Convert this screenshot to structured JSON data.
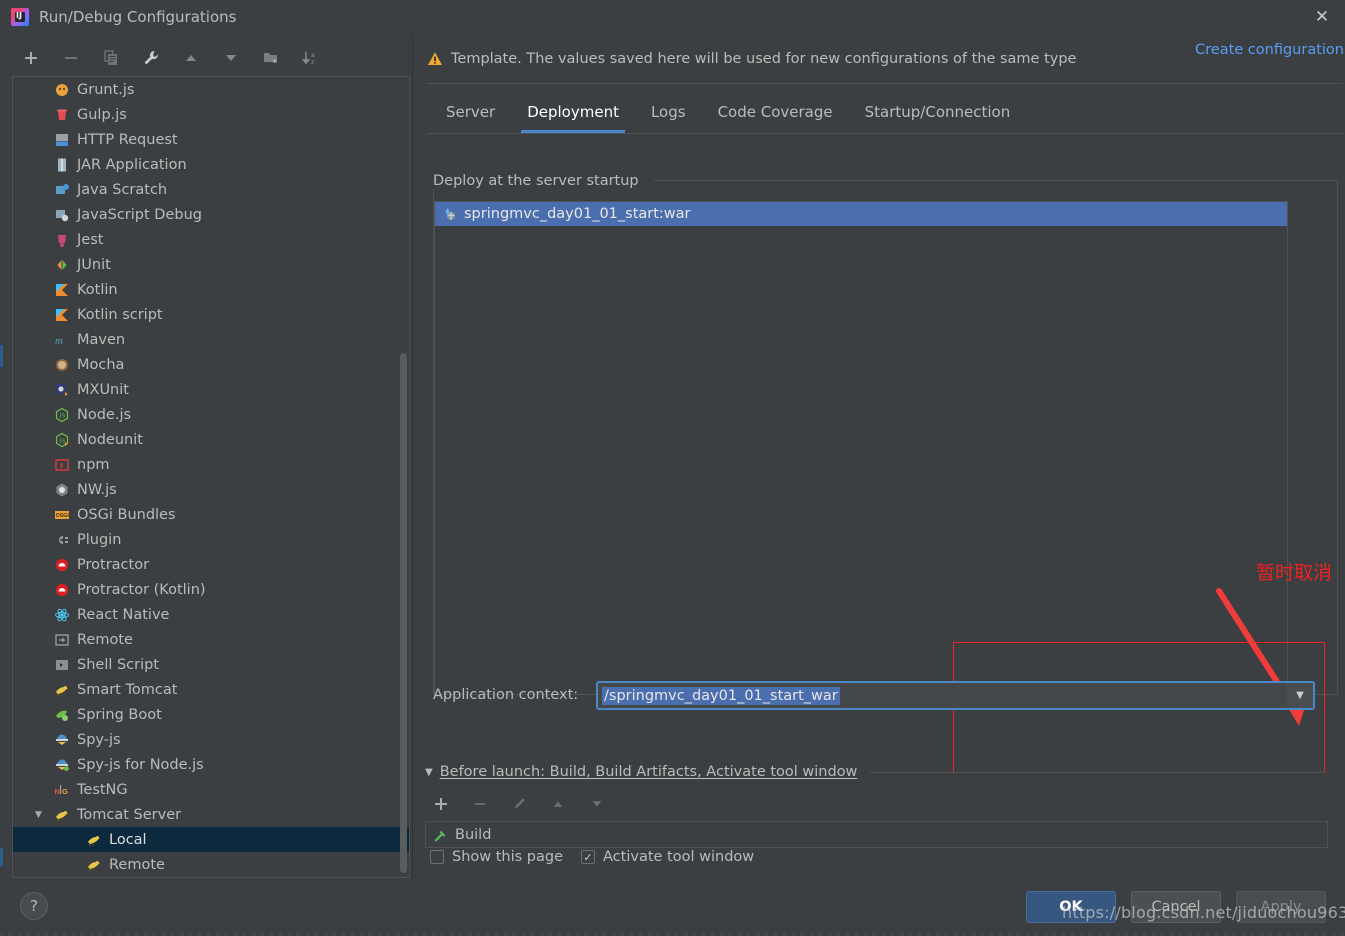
{
  "window": {
    "title": "Run/Debug Configurations",
    "icon": "intellij-idea-icon",
    "close_label": "✕"
  },
  "left_toolbar": {
    "buttons": [
      {
        "name": "add-configuration-button",
        "glyph": "+"
      },
      {
        "name": "remove-configuration-button",
        "glyph": "−"
      },
      {
        "name": "copy-configuration-button",
        "glyph": "copy-icon"
      },
      {
        "name": "edit-templates-button",
        "glyph": "wrench-icon"
      },
      {
        "name": "move-up-button",
        "glyph": "▲"
      },
      {
        "name": "move-down-button",
        "glyph": "▼"
      },
      {
        "name": "new-folder-button",
        "glyph": "folder-add-icon"
      },
      {
        "name": "sort-configurations-button",
        "glyph": "sort-az-icon"
      }
    ]
  },
  "sidebar": {
    "items": [
      {
        "label": "Grunt.js",
        "icon": "grunt-icon",
        "indent": 0
      },
      {
        "label": "Gulp.js",
        "icon": "gulp-icon",
        "indent": 0
      },
      {
        "label": "HTTP Request",
        "icon": "http-request-icon",
        "indent": 0
      },
      {
        "label": "JAR Application",
        "icon": "jar-icon",
        "indent": 0
      },
      {
        "label": "Java Scratch",
        "icon": "java-scratch-icon",
        "indent": 0
      },
      {
        "label": "JavaScript Debug",
        "icon": "javascript-debug-icon",
        "indent": 0
      },
      {
        "label": "Jest",
        "icon": "jest-icon",
        "indent": 0
      },
      {
        "label": "JUnit",
        "icon": "junit-icon",
        "indent": 0
      },
      {
        "label": "Kotlin",
        "icon": "kotlin-icon",
        "indent": 0
      },
      {
        "label": "Kotlin script",
        "icon": "kotlin-script-icon",
        "indent": 0
      },
      {
        "label": "Maven",
        "icon": "maven-icon",
        "indent": 0
      },
      {
        "label": "Mocha",
        "icon": "mocha-icon",
        "indent": 0
      },
      {
        "label": "MXUnit",
        "icon": "mxunit-icon",
        "indent": 0
      },
      {
        "label": "Node.js",
        "icon": "nodejs-icon",
        "indent": 0
      },
      {
        "label": "Nodeunit",
        "icon": "nodeunit-icon",
        "indent": 0
      },
      {
        "label": "npm",
        "icon": "npm-icon",
        "indent": 0
      },
      {
        "label": "NW.js",
        "icon": "nwjs-icon",
        "indent": 0
      },
      {
        "label": "OSGi Bundles",
        "icon": "osgi-icon",
        "indent": 0
      },
      {
        "label": "Plugin",
        "icon": "plugin-icon",
        "indent": 0
      },
      {
        "label": "Protractor",
        "icon": "protractor-icon",
        "indent": 0
      },
      {
        "label": "Protractor (Kotlin)",
        "icon": "protractor-kotlin-icon",
        "indent": 0
      },
      {
        "label": "React Native",
        "icon": "react-native-icon",
        "indent": 0
      },
      {
        "label": "Remote",
        "icon": "remote-icon",
        "indent": 0
      },
      {
        "label": "Shell Script",
        "icon": "shell-script-icon",
        "indent": 0
      },
      {
        "label": "Smart Tomcat",
        "icon": "smart-tomcat-icon",
        "indent": 0
      },
      {
        "label": "Spring Boot",
        "icon": "spring-boot-icon",
        "indent": 0
      },
      {
        "label": "Spy-js",
        "icon": "spy-js-icon",
        "indent": 0
      },
      {
        "label": "Spy-js for Node.js",
        "icon": "spy-js-node-icon",
        "indent": 0
      },
      {
        "label": "TestNG",
        "icon": "testng-icon",
        "indent": 0
      },
      {
        "label": "Tomcat Server",
        "icon": "tomcat-icon",
        "indent": 0,
        "expanded": true,
        "group": true
      },
      {
        "label": "Local",
        "icon": "tomcat-icon",
        "indent": 1,
        "selected": true
      },
      {
        "label": "Remote",
        "icon": "tomcat-icon",
        "indent": 1
      }
    ]
  },
  "header": {
    "warning_icon": "warning-triangle-icon",
    "warning_text": "Template. The values saved here will be used for new configurations of the same type",
    "create_configuration_label": "Create configuration",
    "create_configuration_color": "#589df6"
  },
  "tabs": [
    {
      "label": "Server",
      "active": false
    },
    {
      "label": "Deployment",
      "active": true
    },
    {
      "label": "Logs",
      "active": false
    },
    {
      "label": "Code Coverage",
      "active": false
    },
    {
      "label": "Startup/Connection",
      "active": false
    }
  ],
  "deployment": {
    "group_label": "Deploy at the server startup",
    "items": [
      {
        "label": "springmvc_day01_01_start:war",
        "icon": "war-artifact-icon",
        "selected": true
      }
    ],
    "side_buttons": [
      {
        "name": "add-artifact-button",
        "glyph": "+"
      },
      {
        "name": "remove-artifact-button",
        "glyph": "−"
      },
      {
        "name": "move-artifact-up-button",
        "glyph": "▲"
      },
      {
        "name": "move-artifact-down-button",
        "glyph": "▼"
      },
      {
        "name": "edit-artifact-button",
        "glyph": "pencil-icon"
      }
    ],
    "application_context": {
      "label": "Application context:",
      "value": "/springmvc_day01_01_start_war",
      "placeholder": "",
      "selection_color": "#4b6eaf",
      "border_color": "#4a88c7"
    }
  },
  "annotation": {
    "text": "暂时取消",
    "color": "#ee2222"
  },
  "before_launch": {
    "arrow": "▼",
    "title": "Before launch: Build, Build Artifacts, Activate tool window",
    "toolbar": [
      {
        "name": "add-task-button",
        "glyph": "+",
        "enabled": true
      },
      {
        "name": "remove-task-button",
        "glyph": "−",
        "enabled": false
      },
      {
        "name": "edit-task-button",
        "glyph": "pencil-icon",
        "enabled": false
      },
      {
        "name": "move-task-up-button",
        "glyph": "▲",
        "enabled": false
      },
      {
        "name": "move-task-down-button",
        "glyph": "▼",
        "enabled": false
      }
    ],
    "tasks": [
      {
        "label": "Build",
        "icon": "hammer-icon"
      }
    ],
    "checkboxes": [
      {
        "label": "Show this page",
        "checked": false,
        "name": "show-this-page-checkbox"
      },
      {
        "label": "Activate tool window",
        "checked": true,
        "name": "activate-tool-window-checkbox"
      }
    ]
  },
  "footer": {
    "help_label": "?",
    "ok_label": "OK",
    "cancel_label": "Cancel",
    "apply_label": "Apply",
    "ok_color": "#365880"
  },
  "watermark": {
    "text": "https://blog.csdn.net/jiduochou963"
  }
}
